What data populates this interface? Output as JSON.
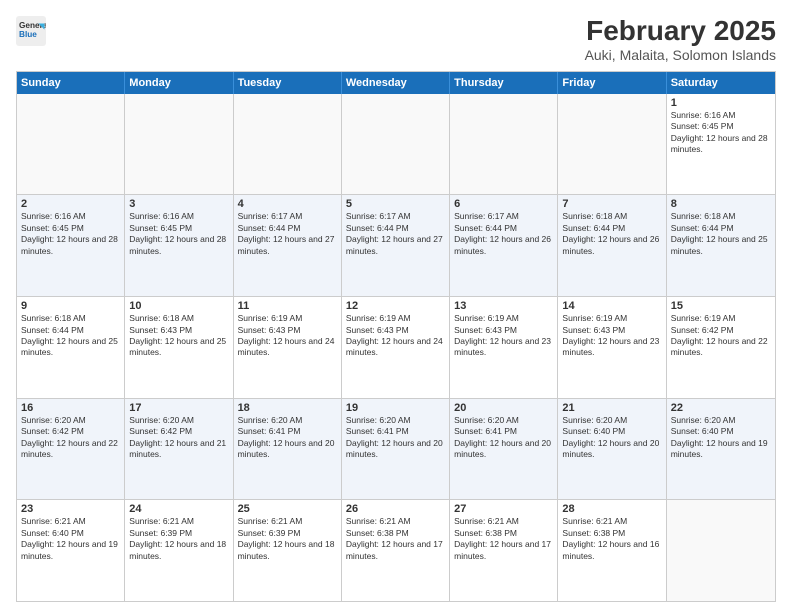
{
  "logo": {
    "line1": "General",
    "line2": "Blue"
  },
  "title": "February 2025",
  "subtitle": "Auki, Malaita, Solomon Islands",
  "days_of_week": [
    "Sunday",
    "Monday",
    "Tuesday",
    "Wednesday",
    "Thursday",
    "Friday",
    "Saturday"
  ],
  "weeks": [
    [
      {
        "day": "",
        "info": ""
      },
      {
        "day": "",
        "info": ""
      },
      {
        "day": "",
        "info": ""
      },
      {
        "day": "",
        "info": ""
      },
      {
        "day": "",
        "info": ""
      },
      {
        "day": "",
        "info": ""
      },
      {
        "day": "1",
        "info": "Sunrise: 6:16 AM\nSunset: 6:45 PM\nDaylight: 12 hours and 28 minutes."
      }
    ],
    [
      {
        "day": "2",
        "info": "Sunrise: 6:16 AM\nSunset: 6:45 PM\nDaylight: 12 hours and 28 minutes."
      },
      {
        "day": "3",
        "info": "Sunrise: 6:16 AM\nSunset: 6:45 PM\nDaylight: 12 hours and 28 minutes."
      },
      {
        "day": "4",
        "info": "Sunrise: 6:17 AM\nSunset: 6:44 PM\nDaylight: 12 hours and 27 minutes."
      },
      {
        "day": "5",
        "info": "Sunrise: 6:17 AM\nSunset: 6:44 PM\nDaylight: 12 hours and 27 minutes."
      },
      {
        "day": "6",
        "info": "Sunrise: 6:17 AM\nSunset: 6:44 PM\nDaylight: 12 hours and 26 minutes."
      },
      {
        "day": "7",
        "info": "Sunrise: 6:18 AM\nSunset: 6:44 PM\nDaylight: 12 hours and 26 minutes."
      },
      {
        "day": "8",
        "info": "Sunrise: 6:18 AM\nSunset: 6:44 PM\nDaylight: 12 hours and 25 minutes."
      }
    ],
    [
      {
        "day": "9",
        "info": "Sunrise: 6:18 AM\nSunset: 6:44 PM\nDaylight: 12 hours and 25 minutes."
      },
      {
        "day": "10",
        "info": "Sunrise: 6:18 AM\nSunset: 6:43 PM\nDaylight: 12 hours and 25 minutes."
      },
      {
        "day": "11",
        "info": "Sunrise: 6:19 AM\nSunset: 6:43 PM\nDaylight: 12 hours and 24 minutes."
      },
      {
        "day": "12",
        "info": "Sunrise: 6:19 AM\nSunset: 6:43 PM\nDaylight: 12 hours and 24 minutes."
      },
      {
        "day": "13",
        "info": "Sunrise: 6:19 AM\nSunset: 6:43 PM\nDaylight: 12 hours and 23 minutes."
      },
      {
        "day": "14",
        "info": "Sunrise: 6:19 AM\nSunset: 6:43 PM\nDaylight: 12 hours and 23 minutes."
      },
      {
        "day": "15",
        "info": "Sunrise: 6:19 AM\nSunset: 6:42 PM\nDaylight: 12 hours and 22 minutes."
      }
    ],
    [
      {
        "day": "16",
        "info": "Sunrise: 6:20 AM\nSunset: 6:42 PM\nDaylight: 12 hours and 22 minutes."
      },
      {
        "day": "17",
        "info": "Sunrise: 6:20 AM\nSunset: 6:42 PM\nDaylight: 12 hours and 21 minutes."
      },
      {
        "day": "18",
        "info": "Sunrise: 6:20 AM\nSunset: 6:41 PM\nDaylight: 12 hours and 20 minutes."
      },
      {
        "day": "19",
        "info": "Sunrise: 6:20 AM\nSunset: 6:41 PM\nDaylight: 12 hours and 20 minutes."
      },
      {
        "day": "20",
        "info": "Sunrise: 6:20 AM\nSunset: 6:41 PM\nDaylight: 12 hours and 20 minutes."
      },
      {
        "day": "21",
        "info": "Sunrise: 6:20 AM\nSunset: 6:40 PM\nDaylight: 12 hours and 20 minutes."
      },
      {
        "day": "22",
        "info": "Sunrise: 6:20 AM\nSunset: 6:40 PM\nDaylight: 12 hours and 19 minutes."
      }
    ],
    [
      {
        "day": "23",
        "info": "Sunrise: 6:21 AM\nSunset: 6:40 PM\nDaylight: 12 hours and 19 minutes."
      },
      {
        "day": "24",
        "info": "Sunrise: 6:21 AM\nSunset: 6:39 PM\nDaylight: 12 hours and 18 minutes."
      },
      {
        "day": "25",
        "info": "Sunrise: 6:21 AM\nSunset: 6:39 PM\nDaylight: 12 hours and 18 minutes."
      },
      {
        "day": "26",
        "info": "Sunrise: 6:21 AM\nSunset: 6:38 PM\nDaylight: 12 hours and 17 minutes."
      },
      {
        "day": "27",
        "info": "Sunrise: 6:21 AM\nSunset: 6:38 PM\nDaylight: 12 hours and 17 minutes."
      },
      {
        "day": "28",
        "info": "Sunrise: 6:21 AM\nSunset: 6:38 PM\nDaylight: 12 hours and 16 minutes."
      },
      {
        "day": "",
        "info": ""
      }
    ]
  ]
}
